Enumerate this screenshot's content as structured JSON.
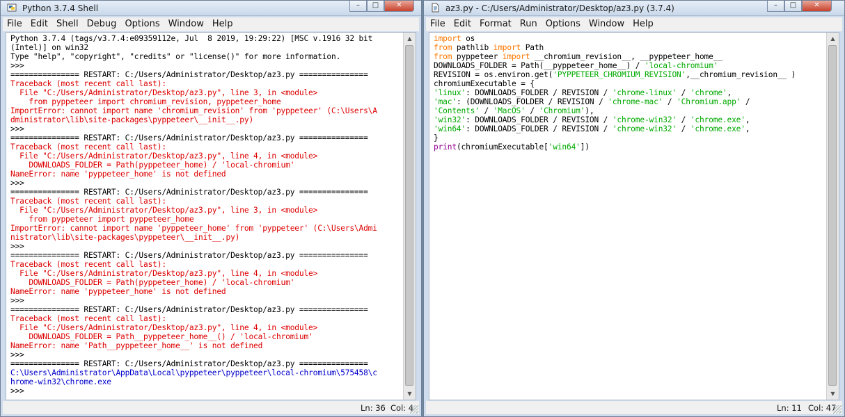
{
  "shell": {
    "title": "Python 3.7.4 Shell",
    "menu": [
      "File",
      "Edit",
      "Shell",
      "Debug",
      "Options",
      "Window",
      "Help"
    ],
    "lines": [
      {
        "t": "Python 3.7.4 (tags/v3.7.4:e09359112e, Jul  8 2019, 19:29:22) [MSC v.1916 32 bit",
        "c": ""
      },
      {
        "t": "(Intel)] on win32",
        "c": ""
      },
      {
        "t": "Type \"help\", \"copyright\", \"credits\" or \"license()\" for more information.",
        "c": ""
      },
      {
        "t": ">>> ",
        "c": ""
      },
      {
        "t": "=============== RESTART: C:/Users/Administrator/Desktop/az3.py ===============",
        "c": ""
      },
      {
        "t": "Traceback (most recent call last):",
        "c": "c-red"
      },
      {
        "t": "  File \"C:/Users/Administrator/Desktop/az3.py\", line 3, in <module>",
        "c": "c-red"
      },
      {
        "t": "    from pyppeteer import chromium_revision, pyppeteer_home",
        "c": "c-red"
      },
      {
        "t": "ImportError: cannot import name 'chromium_revision' from 'pyppeteer' (C:\\Users\\A",
        "c": "c-red"
      },
      {
        "t": "dministrator\\lib\\site-packages\\pyppeteer\\__init__.py)",
        "c": "c-red"
      },
      {
        "t": ">>> ",
        "c": ""
      },
      {
        "t": "=============== RESTART: C:/Users/Administrator/Desktop/az3.py ===============",
        "c": ""
      },
      {
        "t": "Traceback (most recent call last):",
        "c": "c-red"
      },
      {
        "t": "  File \"C:/Users/Administrator/Desktop/az3.py\", line 4, in <module>",
        "c": "c-red"
      },
      {
        "t": "    DOWNLOADS_FOLDER = Path(pyppeteer_home) / 'local-chromium'",
        "c": "c-red"
      },
      {
        "t": "NameError: name 'pyppeteer_home' is not defined",
        "c": "c-red"
      },
      {
        "t": ">>> ",
        "c": ""
      },
      {
        "t": "=============== RESTART: C:/Users/Administrator/Desktop/az3.py ===============",
        "c": ""
      },
      {
        "t": "Traceback (most recent call last):",
        "c": "c-red"
      },
      {
        "t": "  File \"C:/Users/Administrator/Desktop/az3.py\", line 3, in <module>",
        "c": "c-red"
      },
      {
        "t": "    from pyppeteer import pyppeteer_home",
        "c": "c-red"
      },
      {
        "t": "ImportError: cannot import name 'pyppeteer_home' from 'pyppeteer' (C:\\Users\\Admi",
        "c": "c-red"
      },
      {
        "t": "nistrator\\lib\\site-packages\\pyppeteer\\__init__.py)",
        "c": "c-red"
      },
      {
        "t": ">>> ",
        "c": ""
      },
      {
        "t": "=============== RESTART: C:/Users/Administrator/Desktop/az3.py ===============",
        "c": ""
      },
      {
        "t": "Traceback (most recent call last):",
        "c": "c-red"
      },
      {
        "t": "  File \"C:/Users/Administrator/Desktop/az3.py\", line 4, in <module>",
        "c": "c-red"
      },
      {
        "t": "    DOWNLOADS_FOLDER = Path(pyppeteer_home) / 'local-chromium'",
        "c": "c-red"
      },
      {
        "t": "NameError: name 'pyppeteer_home' is not defined",
        "c": "c-red"
      },
      {
        "t": ">>> ",
        "c": ""
      },
      {
        "t": "=============== RESTART: C:/Users/Administrator/Desktop/az3.py ===============",
        "c": ""
      },
      {
        "t": "Traceback (most recent call last):",
        "c": "c-red"
      },
      {
        "t": "  File \"C:/Users/Administrator/Desktop/az3.py\", line 4, in <module>",
        "c": "c-red"
      },
      {
        "t": "    DOWNLOADS_FOLDER = Path__pyppeteer_home__() / 'local-chromium'",
        "c": "c-red"
      },
      {
        "t": "NameError: name 'Path__pyppeteer_home__' is not defined",
        "c": "c-red"
      },
      {
        "t": ">>> ",
        "c": ""
      },
      {
        "t": "=============== RESTART: C:/Users/Administrator/Desktop/az3.py ===============",
        "c": ""
      },
      {
        "t": "C:\\Users\\Administrator\\AppData\\Local\\pyppeteer\\pyppeteer\\local-chromium\\575458\\c",
        "c": "c-blue"
      },
      {
        "t": "hrome-win32\\chrome.exe",
        "c": "c-blue"
      },
      {
        "t": ">>> ",
        "c": ""
      }
    ],
    "status_ln": "Ln: 36",
    "status_col": "Col: 4"
  },
  "editor": {
    "title": "az3.py - C:/Users/Administrator/Desktop/az3.py (3.7.4)",
    "menu": [
      "File",
      "Edit",
      "Format",
      "Run",
      "Options",
      "Window",
      "Help"
    ],
    "lines": [
      [
        {
          "t": "import",
          "c": "c-orange"
        },
        {
          "t": " os",
          "c": ""
        }
      ],
      [
        {
          "t": "from",
          "c": "c-orange"
        },
        {
          "t": " pathlib ",
          "c": ""
        },
        {
          "t": "import",
          "c": "c-orange"
        },
        {
          "t": " Path",
          "c": ""
        }
      ],
      [
        {
          "t": "from",
          "c": "c-orange"
        },
        {
          "t": " pyppeteer ",
          "c": ""
        },
        {
          "t": "import",
          "c": "c-orange"
        },
        {
          "t": " __chromium_revision__, __pyppeteer_home__",
          "c": ""
        }
      ],
      [
        {
          "t": "DOWNLOADS_FOLDER = Path(__pyppeteer_home__) / ",
          "c": ""
        },
        {
          "t": "'local-chromium'",
          "c": "c-green"
        }
      ],
      [
        {
          "t": "REVISION = os.environ.get(",
          "c": ""
        },
        {
          "t": "'PYPPETEER_CHROMIUM_REVISION'",
          "c": "c-green"
        },
        {
          "t": ",__chromium_revision__ )",
          "c": ""
        }
      ],
      [
        {
          "t": "chromiumExecutable = {",
          "c": ""
        }
      ],
      [
        {
          "t": "'linux'",
          "c": "c-green"
        },
        {
          "t": ": DOWNLOADS_FOLDER / REVISION / ",
          "c": ""
        },
        {
          "t": "'chrome-linux'",
          "c": "c-green"
        },
        {
          "t": " / ",
          "c": ""
        },
        {
          "t": "'chrome'",
          "c": "c-green"
        },
        {
          "t": ",",
          "c": ""
        }
      ],
      [
        {
          "t": "'mac'",
          "c": "c-green"
        },
        {
          "t": ": (DOWNLOADS_FOLDER / REVISION / ",
          "c": ""
        },
        {
          "t": "'chrome-mac'",
          "c": "c-green"
        },
        {
          "t": " / ",
          "c": ""
        },
        {
          "t": "'Chromium.app'",
          "c": "c-green"
        },
        {
          "t": " /",
          "c": ""
        }
      ],
      [
        {
          "t": "'Contents'",
          "c": "c-green"
        },
        {
          "t": " / ",
          "c": ""
        },
        {
          "t": "'MacOS'",
          "c": "c-green"
        },
        {
          "t": " / ",
          "c": ""
        },
        {
          "t": "'Chromium'",
          "c": "c-green"
        },
        {
          "t": "),",
          "c": ""
        }
      ],
      [
        {
          "t": "'win32'",
          "c": "c-green"
        },
        {
          "t": ": DOWNLOADS_FOLDER / REVISION / ",
          "c": ""
        },
        {
          "t": "'chrome-win32'",
          "c": "c-green"
        },
        {
          "t": " / ",
          "c": ""
        },
        {
          "t": "'chrome.exe'",
          "c": "c-green"
        },
        {
          "t": ",",
          "c": ""
        }
      ],
      [
        {
          "t": "'win64'",
          "c": "c-green"
        },
        {
          "t": ": DOWNLOADS_FOLDER / REVISION / ",
          "c": ""
        },
        {
          "t": "'chrome-win32'",
          "c": "c-green"
        },
        {
          "t": " / ",
          "c": ""
        },
        {
          "t": "'chrome.exe'",
          "c": "c-green"
        },
        {
          "t": ",",
          "c": ""
        }
      ],
      [
        {
          "t": "}",
          "c": ""
        }
      ],
      [
        {
          "t": "print",
          "c": "c-purple"
        },
        {
          "t": "(chromiumExecutable[",
          "c": ""
        },
        {
          "t": "'win64'",
          "c": "c-green"
        },
        {
          "t": "])",
          "c": ""
        }
      ]
    ],
    "status_ln": "Ln: 11",
    "status_col": "Col: 47"
  },
  "window_controls": {
    "minimize": "–",
    "maximize": "□",
    "close": "✕"
  },
  "colors": {
    "error": "#dd0000",
    "output": "#0000cc",
    "keyword": "#ff7700",
    "string": "#00aa00",
    "builtin": "#900090"
  }
}
